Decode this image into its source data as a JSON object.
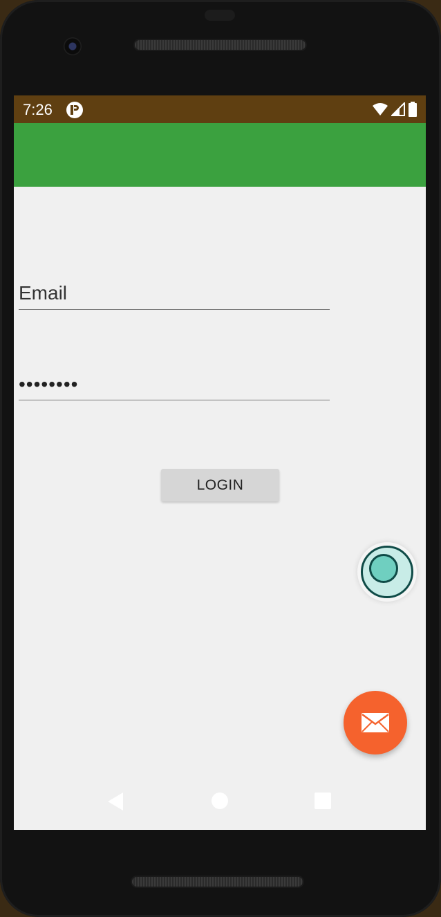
{
  "status_bar": {
    "time": "7:26",
    "app_icon": "pocket-casts-style-icon",
    "icons": [
      "wifi-icon",
      "signal-icon",
      "battery-icon"
    ],
    "background": "#5f3f11"
  },
  "app_bar": {
    "background": "#3ba13f"
  },
  "form": {
    "email_placeholder": "Email",
    "password_value": "••••••••",
    "login_label": "LOGIN"
  },
  "floating_widget": {
    "icon": "record-icon"
  },
  "fab": {
    "icon": "mail-icon",
    "color": "#f5622d"
  },
  "nav_bar": {
    "items": [
      "back-icon",
      "home-icon",
      "recents-icon"
    ]
  }
}
